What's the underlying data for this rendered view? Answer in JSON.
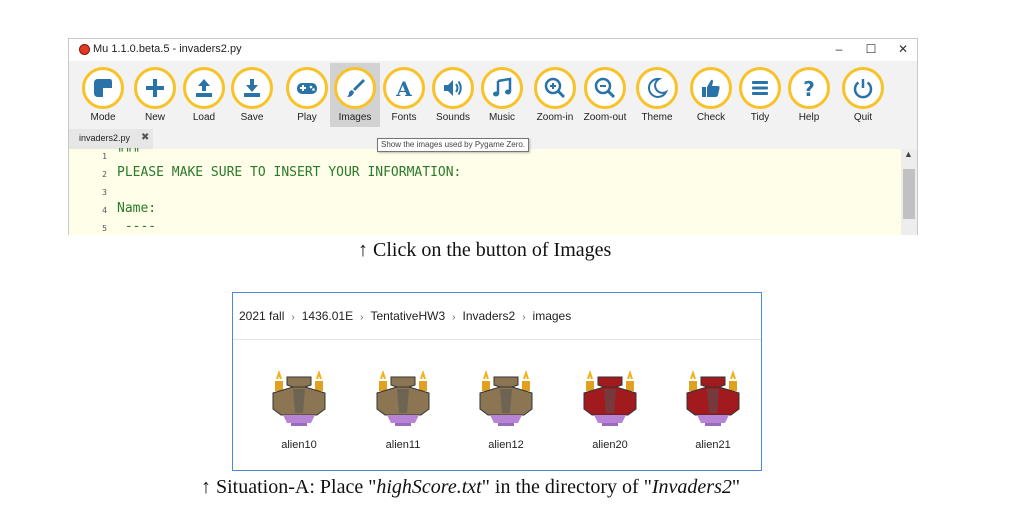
{
  "window": {
    "title": "Mu 1.1.0.beta.5 - invaders2.py",
    "min_glyph": "–",
    "max_glyph": "☐",
    "close_glyph": "✕"
  },
  "toolbar": {
    "buttons": [
      {
        "label": "Mode",
        "icon": "mode-icon"
      },
      {
        "label": "New",
        "icon": "plus-icon"
      },
      {
        "label": "Load",
        "icon": "upload-icon"
      },
      {
        "label": "Save",
        "icon": "download-icon"
      },
      {
        "label": "Play",
        "icon": "gamepad-icon"
      },
      {
        "label": "Images",
        "icon": "brush-icon"
      },
      {
        "label": "Fonts",
        "icon": "font-icon"
      },
      {
        "label": "Sounds",
        "icon": "speaker-icon"
      },
      {
        "label": "Music",
        "icon": "music-note-icon"
      },
      {
        "label": "Zoom-in",
        "icon": "zoom-in-icon"
      },
      {
        "label": "Zoom-out",
        "icon": "zoom-out-icon"
      },
      {
        "label": "Theme",
        "icon": "moon-icon"
      },
      {
        "label": "Check",
        "icon": "thumbs-up-icon"
      },
      {
        "label": "Tidy",
        "icon": "tidy-lines-icon"
      },
      {
        "label": "Help",
        "icon": "question-icon"
      },
      {
        "label": "Quit",
        "icon": "power-icon"
      }
    ],
    "active_button": "Images",
    "tooltip": "Show the images used by Pygame Zero.",
    "icon_accent": "#f8c22a",
    "icon_color": "#2a73a8"
  },
  "tab": {
    "label": "invaders2.py",
    "close_glyph": "✖"
  },
  "editor": {
    "lines": [
      {
        "number": "1",
        "text": "\"\"\""
      },
      {
        "number": "2",
        "text": "PLEASE MAKE SURE TO INSERT YOUR INFORMATION:"
      },
      {
        "number": "3",
        "text": ""
      },
      {
        "number": "4",
        "text": "Name:"
      },
      {
        "number": "5",
        "text": " ----"
      }
    ],
    "scroll_up_glyph": "▲"
  },
  "captions": {
    "first": "↑ Click on the button of Images",
    "second_prefix": "↑ Situation-A: Place \"",
    "second_file": "highScore.txt",
    "second_mid": "\" in the directory of \"",
    "second_dir": "Invaders2",
    "second_suffix": "\""
  },
  "explorer": {
    "breadcrumb": [
      "2021 fall",
      "1436.01E",
      "TentativeHW3",
      "Invaders2",
      "images"
    ],
    "separator": "›",
    "files": [
      {
        "name": "alien10",
        "color": "#8c7552"
      },
      {
        "name": "alien11",
        "color": "#8c7552"
      },
      {
        "name": "alien12",
        "color": "#8c7552"
      },
      {
        "name": "alien20",
        "color": "#a01a1e"
      },
      {
        "name": "alien21",
        "color": "#a01a1e"
      }
    ]
  }
}
